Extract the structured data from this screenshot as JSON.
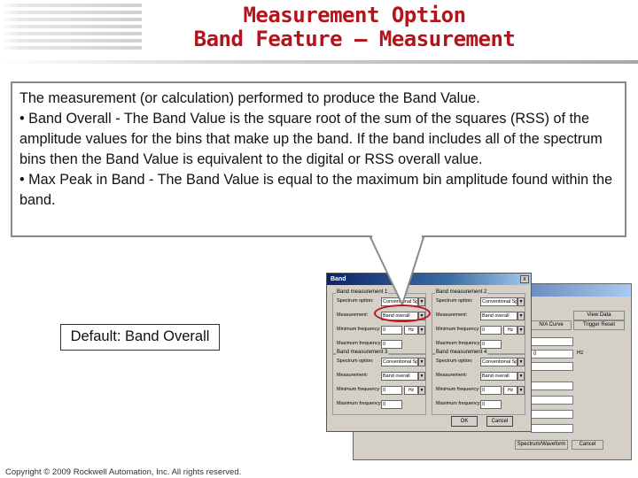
{
  "slide": {
    "title_line1": "Measurement Option",
    "title_line2": "Band Feature – Measurement",
    "callout": {
      "intro": "The measurement (or calculation) performed to produce the Band Value.",
      "bullet1": "• Band Overall - The Band Value is the square root of the sum of the squares (RSS) of the amplitude values for the bins that make up the band. If the band includes all of the spectrum bins then the Band Value is equivalent to the digital or RSS overall value.",
      "bullet2": "• Max Peak in Band - The Band Value is equal to the maximum bin amplitude found within the band."
    },
    "default_label": "Default: Band Overall",
    "copyright": "Copyright © 2009 Rockwell Automation, Inc. All rights reserved."
  },
  "dialog": {
    "title": "Band",
    "close": "x",
    "groups": [
      {
        "title": "Band measurement 1",
        "spectrum_option_label": "Spectrum option:",
        "spectrum_option_value": "Conventional Spectr",
        "measurement_label": "Measurement:",
        "measurement_value": "Band overall",
        "min_freq_label": "Minimum frequency:",
        "min_freq_value": "0",
        "min_freq_unit": "Hz",
        "max_freq_label": "Maximum frequency:",
        "max_freq_value": "0"
      },
      {
        "title": "Band measurement 2",
        "spectrum_option_label": "Spectrum option:",
        "spectrum_option_value": "Conventional Spectr",
        "measurement_label": "Measurement:",
        "measurement_value": "Band overall",
        "min_freq_label": "Minimum frequency:",
        "min_freq_value": "0",
        "min_freq_unit": "Hz",
        "max_freq_label": "Maximum frequency:",
        "max_freq_value": "0"
      },
      {
        "title": "Band measurement 3",
        "spectrum_option_label": "Spectrum option:",
        "spectrum_option_value": "Conventional Spectr",
        "measurement_label": "Measurement:",
        "measurement_value": "Band overall",
        "min_freq_label": "Minimum frequency:",
        "min_freq_value": "0",
        "min_freq_unit": "Hz",
        "max_freq_label": "Maximum frequency:",
        "max_freq_value": "0"
      },
      {
        "title": "Band measurement 4",
        "spectrum_option_label": "Spectrum option:",
        "spectrum_option_value": "Conventional Spectr",
        "measurement_label": "Measurement:",
        "measurement_value": "Band overall",
        "min_freq_label": "Minimum frequency:",
        "min_freq_value": "0",
        "min_freq_unit": "Hz",
        "max_freq_label": "Maximum frequency:",
        "max_freq_value": "0"
      }
    ],
    "ok_label": "OK",
    "cancel_label": "Cancel"
  },
  "background_window": {
    "btn_view_data": "View Data",
    "btn_nfa_curve": "N/A Curve",
    "btn_trigger_reset": "Trigger Reset",
    "field_value": "0",
    "unit_hz": "Hz",
    "btn_spectrum_waveform": "Spectrum/Waveform",
    "btn_cancel": "Cancel"
  },
  "colors": {
    "title_red": "#b3141b",
    "highlight_circle": "#c0151b",
    "dialog_face": "#d4d0c8",
    "titlebar_dark": "#0a246a"
  }
}
